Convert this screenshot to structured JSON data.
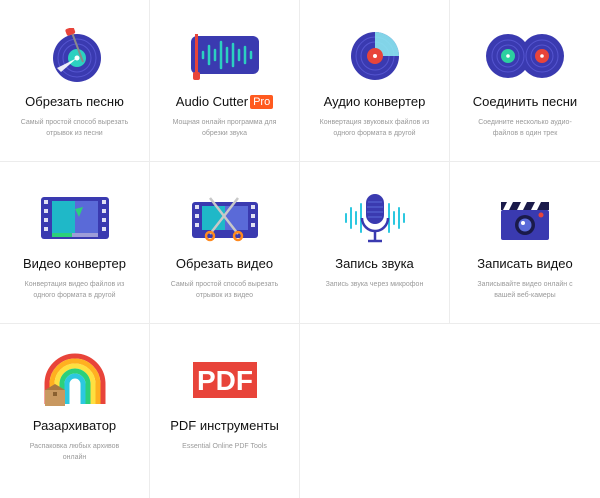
{
  "tools": [
    {
      "title": "Обрезать песню",
      "desc": "Самый простой способ вырезать отрывок из песни",
      "icon": "cut-song-icon"
    },
    {
      "title": "Audio Cutter",
      "badge": "Pro",
      "desc": "Мощная онлайн программа для обрезки звука",
      "icon": "audio-cutter-pro-icon"
    },
    {
      "title": "Аудио конвертер",
      "desc": "Конвертация звуковых файлов из одного формата в другой",
      "icon": "audio-converter-icon"
    },
    {
      "title": "Соединить песни",
      "desc": "Соедините несколько аудио-файлов в один трек",
      "icon": "join-songs-icon"
    },
    {
      "title": "Видео конвертер",
      "desc": "Конвертация видео файлов из одного формата в другой",
      "icon": "video-converter-icon"
    },
    {
      "title": "Обрезать видео",
      "desc": "Самый простой способ вырезать отрывок из видео",
      "icon": "cut-video-icon"
    },
    {
      "title": "Запись звука",
      "desc": "Запись звука через микрофон",
      "icon": "microphone-icon"
    },
    {
      "title": "Записать видео",
      "desc": "Записывайте видео онлайн с вашей веб-камеры",
      "icon": "video-recorder-icon"
    },
    {
      "title": "Разархиватор",
      "desc": "Распаковка любых архивов онлайн",
      "icon": "archive-extractor-icon"
    },
    {
      "title": "PDF инструменты",
      "desc": "Essential Online PDF Tools",
      "icon": "pdf-tools-icon",
      "icon_text": "PDF"
    }
  ],
  "colors": {
    "navy": "#3a3ab0",
    "red": "#e8443a",
    "teal": "#2cd0c0",
    "orange": "#ff5a1f",
    "pdf": "#e8443a"
  }
}
